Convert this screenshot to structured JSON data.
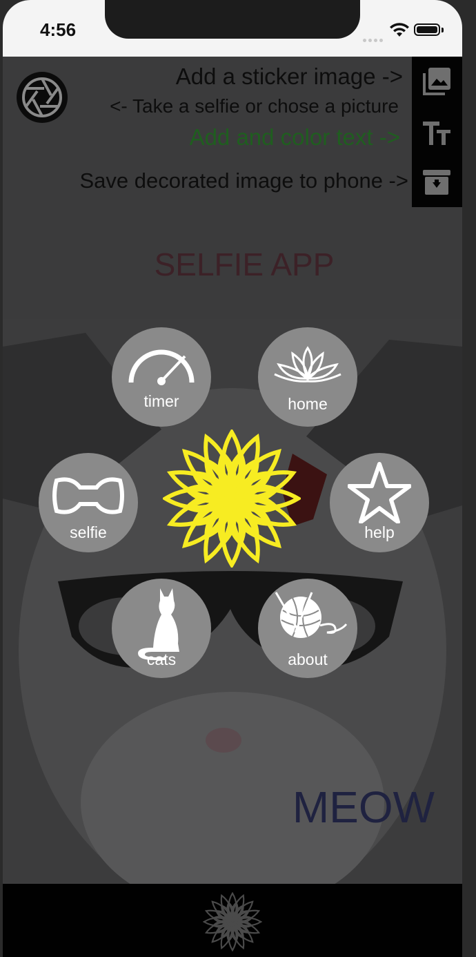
{
  "status_bar": {
    "time": "4:56"
  },
  "hints": {
    "sticker": "Add a sticker image ->",
    "selfie": "<- Take a selfie or chose a picture",
    "text": "Add and color text ->",
    "save": "Save decorated image to phone ->"
  },
  "app_title": "SELFIE APP",
  "caption": "MEOW",
  "menu": {
    "timer": "timer",
    "home": "home",
    "selfie": "selfie",
    "help": "help",
    "cats": "cats",
    "about": "about"
  },
  "icons": {
    "shutter": "camera-shutter-icon",
    "sticker": "image-stack-icon",
    "text": "text-size-icon",
    "save": "save-download-icon",
    "center": "yellow-flower-icon",
    "bottom": "flower-outline-icon"
  },
  "colors": {
    "text_hint": "#1f5e1f",
    "title": "#3c2127",
    "caption": "#1f2240",
    "center_flower": "#f7ec22",
    "menu_circle": "#8a8a8a"
  }
}
